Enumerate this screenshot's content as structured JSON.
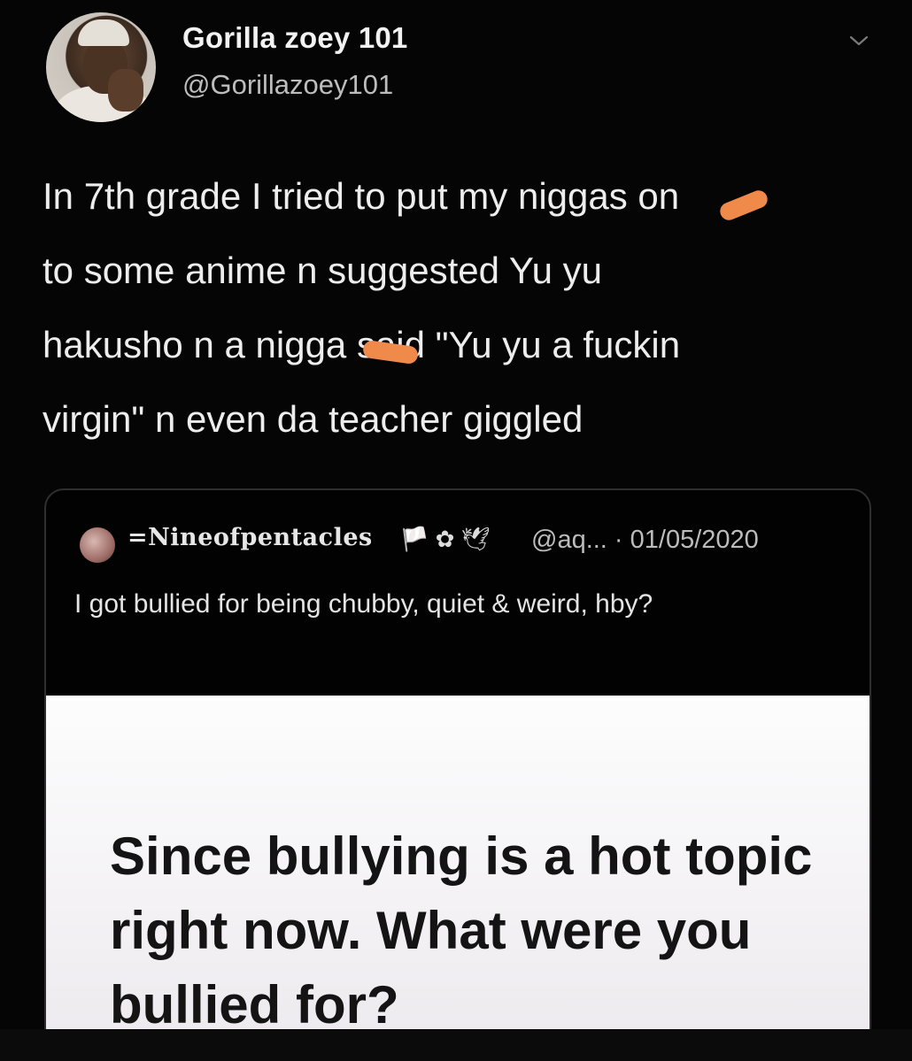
{
  "tweet": {
    "display_name": "Gorilla zoey 101",
    "handle": "@Gorillazoey101",
    "menu_icon": "chevron-down-icon",
    "text": "In 7th grade I tried to put my niggas on\nto some anime n suggested Yu yu\nhakusho n a nigga said \"Yu yu a fuckin\nvirgin\" n even da teacher giggled",
    "censor_color": "#f08a4b"
  },
  "quoted_tweet": {
    "display_name": "=Nineofpentacles",
    "badges": "🏳️ ✿ 🕊",
    "handle_date": "@aq... · 01/05/2020",
    "text": "I got bullied for being chubby, quiet & weird, hby?",
    "media_text": "Since bullying is a hot topic right now. What were you bullied for?"
  }
}
